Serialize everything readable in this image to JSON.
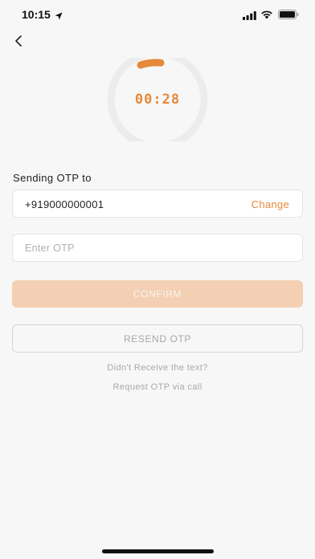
{
  "status_bar": {
    "time": "10:15"
  },
  "timer": {
    "value": "00:28",
    "accent_color": "#e5893b",
    "track_color": "#ececec"
  },
  "form": {
    "sending_label": "Sending OTP to",
    "phone_number": "+919000000001",
    "change_label": "Change",
    "otp_placeholder": "Enter OTP",
    "otp_value": "",
    "confirm_label": "CONFIRM",
    "resend_label": "RESEND OTP",
    "didnt_receive": "Didn't Receive the text?",
    "request_call": "Request OTP via call"
  },
  "colors": {
    "accent": "#e5893b",
    "confirm_disabled_bg": "#f3d0b3"
  },
  "icons": {
    "back": "chevron-left-icon",
    "location": "location-arrow-icon",
    "signal": "cellular-signal-icon",
    "wifi": "wifi-icon",
    "battery": "battery-icon"
  }
}
